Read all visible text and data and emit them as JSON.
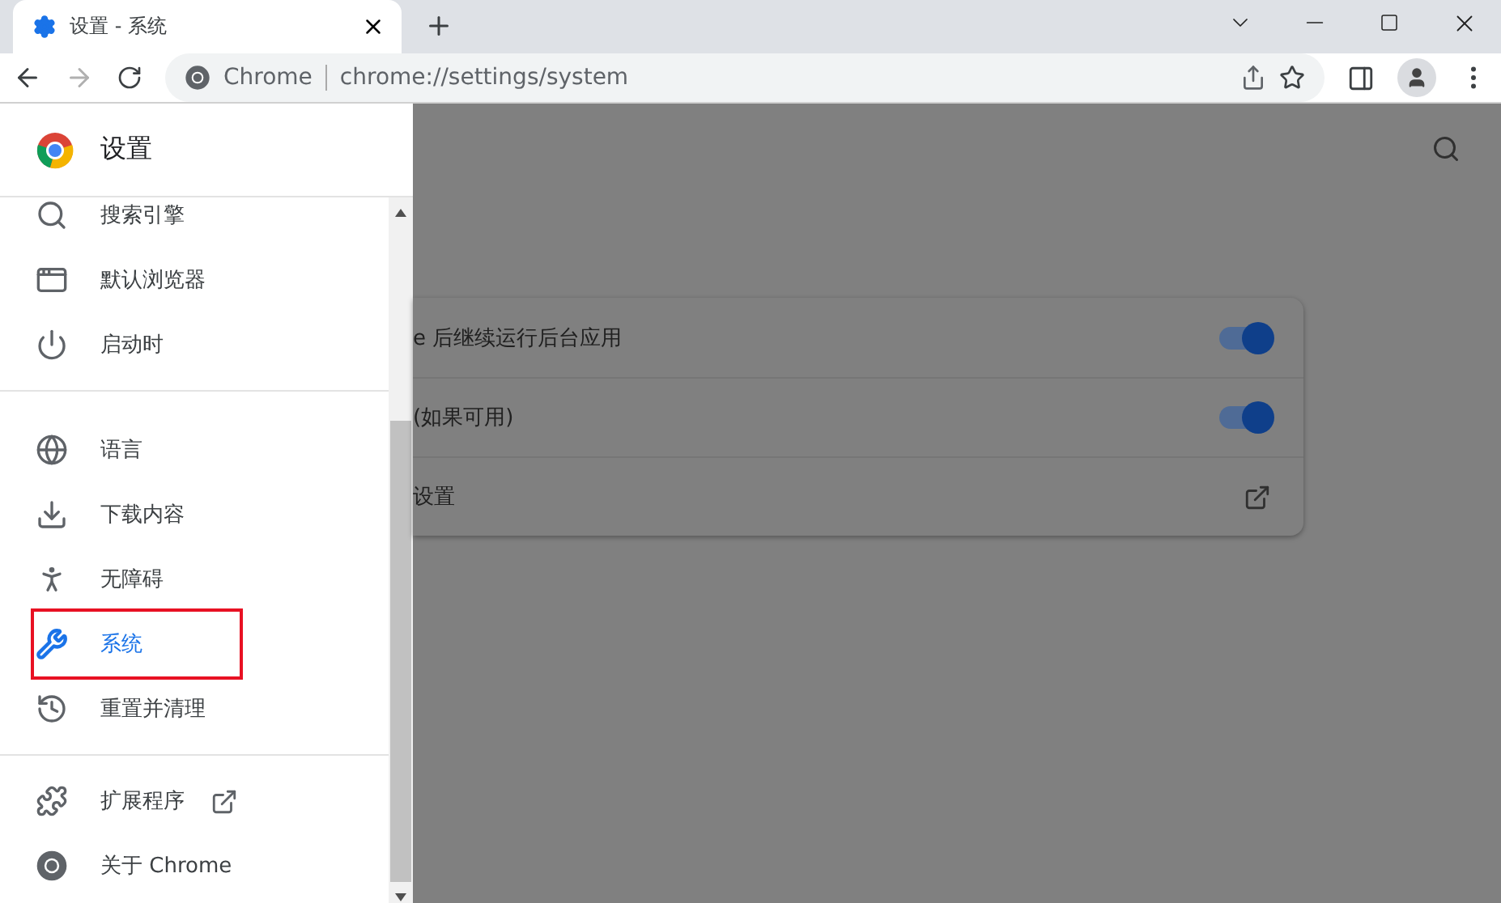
{
  "tab": {
    "title": "设置 - 系统",
    "selected": true
  },
  "omnibox": {
    "site": "Chrome",
    "url": "chrome://settings/system"
  },
  "drawer": {
    "title": "设置",
    "groups": [
      [
        {
          "label": "搜索引擎",
          "selected": false
        },
        {
          "label": "默认浏览器",
          "selected": false
        },
        {
          "label": "启动时",
          "selected": false
        }
      ],
      [
        {
          "label": "语言",
          "selected": false
        },
        {
          "label": "下载内容",
          "selected": false
        },
        {
          "label": "无障碍",
          "selected": false
        },
        {
          "label": "系统",
          "selected": true
        },
        {
          "label": "重置并清理",
          "selected": false
        }
      ],
      [
        {
          "label": "扩展程序",
          "selected": false,
          "external": true
        },
        {
          "label": "关于 Chrome",
          "selected": false,
          "external": false
        }
      ]
    ]
  },
  "settings": [
    {
      "label": "e 后继续运行后台应用",
      "kind": "toggle",
      "on": true
    },
    {
      "label": "(如果可用)",
      "kind": "toggle",
      "on": true
    },
    {
      "label": "设置",
      "kind": "link"
    }
  ]
}
